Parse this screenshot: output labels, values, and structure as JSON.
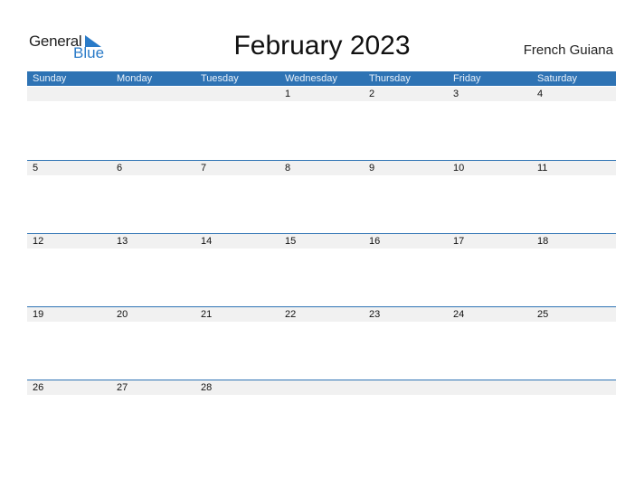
{
  "logo": {
    "general": "General",
    "blue": "Blue"
  },
  "title": "February 2023",
  "country": "French Guiana",
  "colors": {
    "accent": "#2e73b4",
    "date_bar": "#f1f1f1"
  },
  "weekdays": [
    "Sunday",
    "Monday",
    "Tuesday",
    "Wednesday",
    "Thursday",
    "Friday",
    "Saturday"
  ],
  "weeks": [
    [
      "",
      "",
      "",
      "1",
      "2",
      "3",
      "4"
    ],
    [
      "5",
      "6",
      "7",
      "8",
      "9",
      "10",
      "11"
    ],
    [
      "12",
      "13",
      "14",
      "15",
      "16",
      "17",
      "18"
    ],
    [
      "19",
      "20",
      "21",
      "22",
      "23",
      "24",
      "25"
    ],
    [
      "26",
      "27",
      "28",
      "",
      "",
      "",
      ""
    ]
  ]
}
